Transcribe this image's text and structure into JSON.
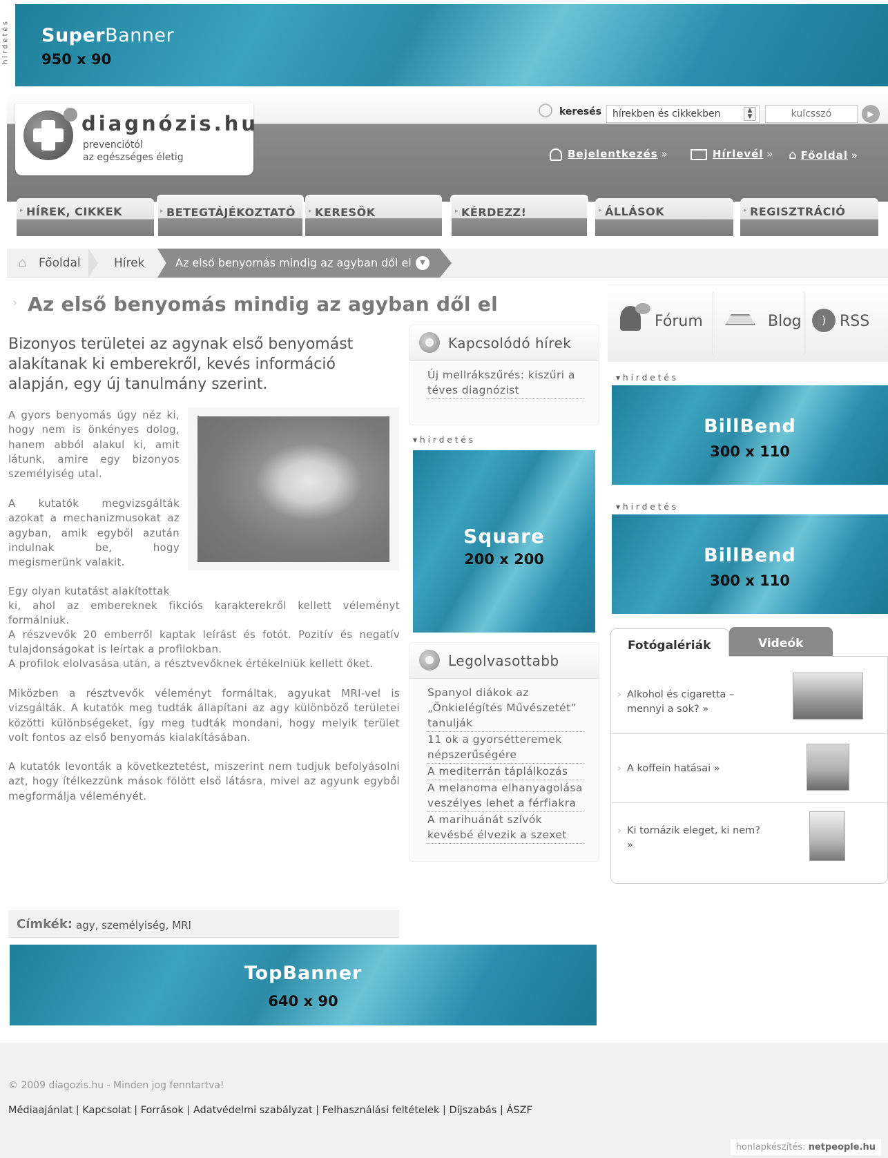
{
  "top_ad": {
    "label": "hirdetés",
    "title_bold": "Super",
    "title_rest": "Banner",
    "size": "950 x 90"
  },
  "header": {
    "logo_name": "diagnózis.hu",
    "logo_tag1": "prevenciótól",
    "logo_tag2": "az egészséges életig",
    "search_label": "keresés",
    "search_scope": "hírekben és cikkekben",
    "search_placeholder": "kulcsszó",
    "links": [
      {
        "label": "Bejelentkezés",
        "arrow": "»"
      },
      {
        "label": "Hírlevél",
        "arrow": "»"
      },
      {
        "label": "Főoldal",
        "arrow": "»"
      }
    ]
  },
  "nav": [
    "HÍREK, CIKKEK",
    "BETEGTÁJÉKOZTATÓ",
    "KERESŐK",
    "KÉRDEZZ!",
    "ÁLLÁSOK",
    "REGISZTRÁCIÓ"
  ],
  "breadcrumb": [
    "Főoldal",
    "Hírek",
    "Az első benyomás mindig az agyban dől el"
  ],
  "article": {
    "title": "Az első benyomás mindig az agyban dől el",
    "lead": "Bizonyos területei az agynak első benyomást alakítanak ki emberekről, kevés információ alapján, egy új tanulmány szerint.",
    "p1": "A gyors benyomás úgy néz ki, hogy nem is önkényes dolog, hanem abból alakul ki, amit látunk, amire egy bizonyos személyiség utal.",
    "p2": "A kutatók megvizsgálták azokat a mechanizmusokat az agyban, amik egyből azután indulnak be, hogy megismerünk valakit.",
    "p3a": "Egy olyan kutatást alakítottak",
    "p3b": "ki, ahol az embereknek fikciós karakterekről kellett véleményt formálniuk.",
    "p3c": "A részvevők 20 emberről kaptak leírást és fotót. Pozitív és negatív tulajdonságokat is leírtak a profilokban.",
    "p3d": "A profilok elolvasása után, a résztvevőknek értékelniük kellett őket.",
    "p4": "Miközben a résztvevők véleményt formáltak, agyukat MRI-vel is vizsgálták. A kutatók meg tudták állapítani az agy különböző területei közötti különbségeket, így meg tudták mondani, hogy melyik terület volt fontos az első benyomás kialakításában.",
    "p5": "A kutatók levonták a következtetést, miszerint nem tudjuk befolyásolni azt, hogy ítélkezzünk mások fölött első látásra, mivel az agyunk egyből megformálja véleményét."
  },
  "related": {
    "title": "Kapcsolódó hírek",
    "items": [
      "Új mellrákszűrés: kiszűri a",
      "téves diagnózist"
    ]
  },
  "square_ad": {
    "label": "hirdetés",
    "title": "Square",
    "size": "200 x 200"
  },
  "most_read": {
    "title": "Legolvasottabb",
    "items": [
      "Spanyol diákok az",
      "„Önkielégítés Művészetét”",
      "tanulják",
      "11 ok a gyorsétteremek",
      "népszerűségére",
      "A mediterrán táplálkozás",
      "A melanoma elhanyagolása",
      "veszélyes lehet a férfiakra",
      "A marihuánát szívók",
      "kevésbé élvezik a szexet"
    ]
  },
  "social": {
    "forum": "Fórum",
    "blog": "Blog",
    "rss": "RSS"
  },
  "billbend": {
    "label": "hirdetés",
    "title": "BillBend",
    "size": "300 x 110"
  },
  "gallery": {
    "tab_active": "Fotógalériák",
    "tab_inactive": "Videók",
    "items": [
      {
        "l1": "Alkohol és cigaretta –",
        "l2": "mennyi a sok? »"
      },
      {
        "l1": "A koffein hatásai »",
        "l2": ""
      },
      {
        "l1": "Ki tornázik eleget, ki nem?",
        "l2": "»"
      }
    ]
  },
  "tags": {
    "label": "Címkék:",
    "value": "agy, személyiség, MRI"
  },
  "top_banner": {
    "title": "TopBanner",
    "size": "640 x 90"
  },
  "footer": {
    "copyright": "© 2009 diagozis.hu - Minden jog fenntartva!",
    "links": [
      "Médiaajánlat",
      "Kapcsolat",
      "Források",
      "Adatvédelmi szabályzat",
      "Felhasználási feltételek",
      "Díjszabás",
      "ÁSZF"
    ],
    "credit_label": "honlapkészítés:",
    "credit_name": "netpeople.hu"
  }
}
